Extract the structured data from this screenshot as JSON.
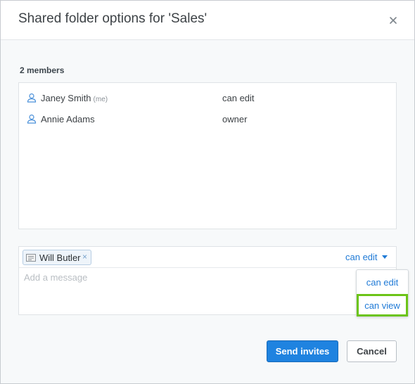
{
  "dialog": {
    "title": "Shared folder options for 'Sales'",
    "close_icon": "close-icon"
  },
  "members": {
    "count_label": "2 members",
    "rows": [
      {
        "name": "Janey Smith",
        "tag": "(me)",
        "permission": "can edit",
        "icon": "user-icon"
      },
      {
        "name": "Annie Adams",
        "tag": "",
        "permission": "owner",
        "icon": "user-icon"
      }
    ]
  },
  "invite": {
    "recipient": {
      "name": "Will Butler",
      "icon": "contact-card-icon",
      "remove_glyph": "×"
    },
    "permission_selected": "can edit",
    "message_placeholder": "Add a message",
    "permission_options": [
      "can edit",
      "can view"
    ],
    "highlighted_option": "can view"
  },
  "actions": {
    "primary_label": "Send invites",
    "secondary_label": "Cancel"
  },
  "colors": {
    "accent": "#1f7ad6",
    "primary_button": "#1f83e0",
    "highlight_border": "#6cc417"
  }
}
